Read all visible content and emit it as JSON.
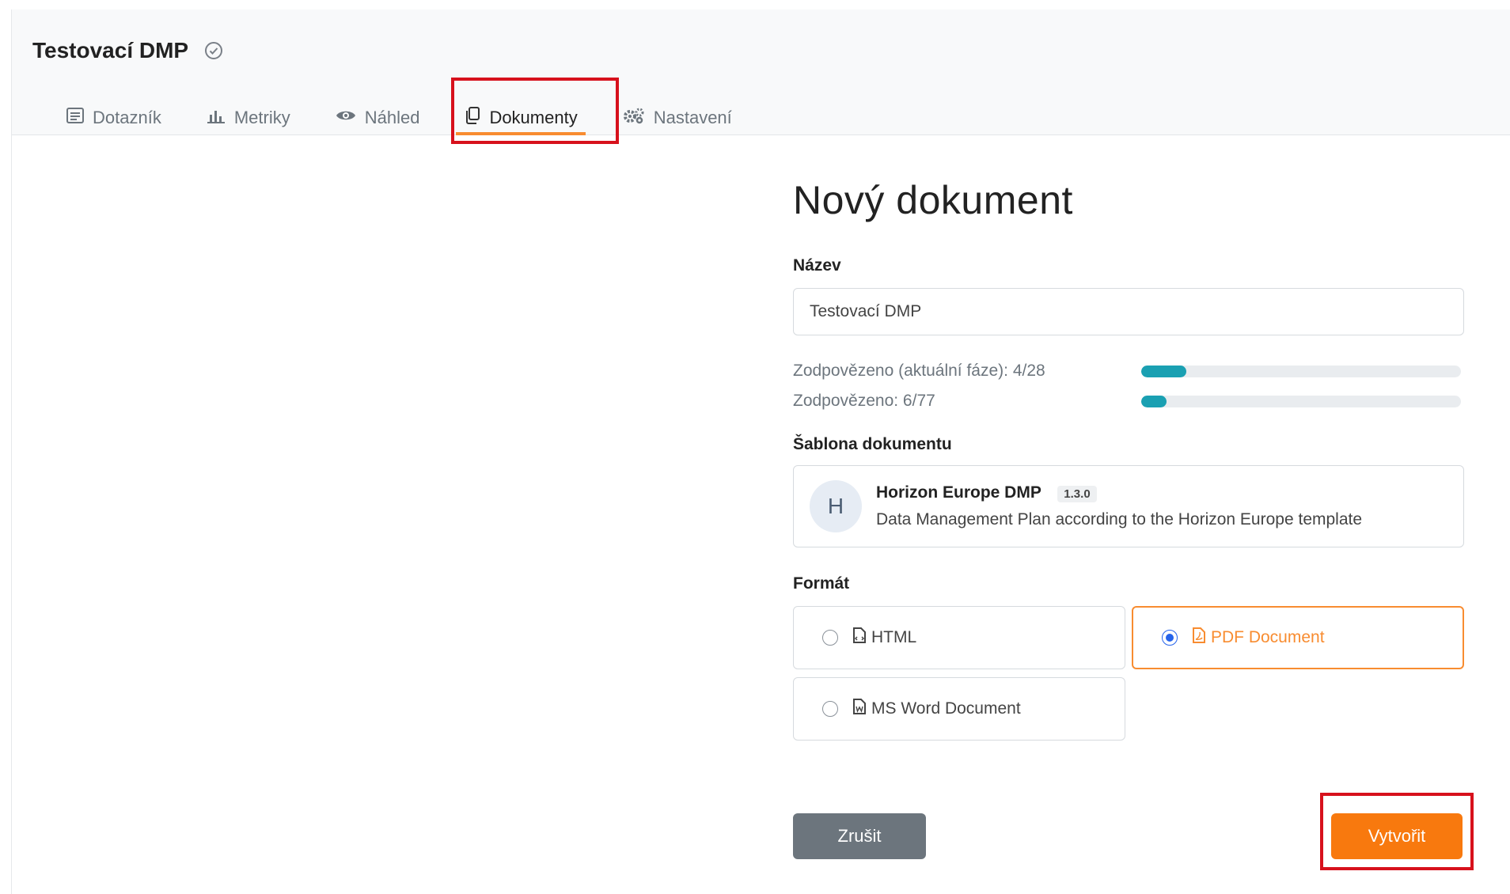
{
  "project": {
    "title": "Testovací DMP"
  },
  "tabs": [
    {
      "label": "Dotazník",
      "icon": "list-icon"
    },
    {
      "label": "Metriky",
      "icon": "bar-chart-icon"
    },
    {
      "label": "Náhled",
      "icon": "eye-icon"
    },
    {
      "label": "Dokumenty",
      "icon": "documents-icon",
      "active": true
    },
    {
      "label": "Nastavení",
      "icon": "gears-icon"
    }
  ],
  "form": {
    "heading": "Nový dokument",
    "name_label": "Název",
    "name_value": "Testovací DMP",
    "progress": [
      {
        "text": "Zodpovězeno (aktuální fáze): 4/28",
        "fraction": 0.14
      },
      {
        "text": "Zodpovězeno: 6/77",
        "fraction": 0.08
      }
    ],
    "template_label": "Šablona dokumentu",
    "template": {
      "avatar": "H",
      "name": "Horizon Europe DMP",
      "version": "1.3.0",
      "description": "Data Management Plan according to the Horizon Europe template"
    },
    "format_label": "Formát",
    "formats": [
      {
        "label": "HTML",
        "selected": false
      },
      {
        "label": "PDF Document",
        "selected": true
      },
      {
        "label": "MS Word Document",
        "selected": false
      }
    ],
    "cancel_label": "Zrušit",
    "create_label": "Vytvořit"
  },
  "colors": {
    "accent": "#f8790e",
    "progress": "#1aa0b2",
    "highlight": "#d7111c",
    "cancel": "#6c757d"
  }
}
